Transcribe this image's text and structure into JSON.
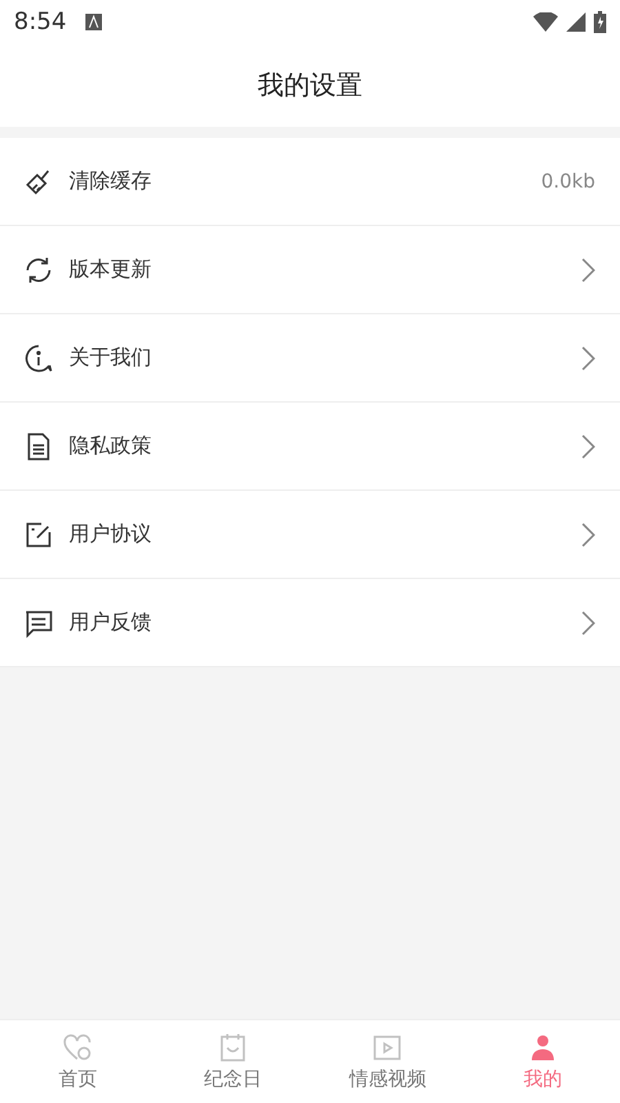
{
  "status_bar": {
    "time": "8:54"
  },
  "header": {
    "title": "我的设置"
  },
  "settings": [
    {
      "label": "清除缓存",
      "kind": "value",
      "value": "0.0kb"
    },
    {
      "label": "版本更新",
      "kind": "arrow"
    },
    {
      "label": "关于我们",
      "kind": "arrow"
    },
    {
      "label": "隐私政策",
      "kind": "arrow"
    },
    {
      "label": "用户协议",
      "kind": "arrow"
    },
    {
      "label": "用户反馈",
      "kind": "arrow"
    }
  ],
  "tabs": [
    {
      "label": "首页",
      "selected": false
    },
    {
      "label": "纪念日",
      "selected": false
    },
    {
      "label": "情感视频",
      "selected": false
    },
    {
      "label": "我的",
      "selected": true
    }
  ]
}
